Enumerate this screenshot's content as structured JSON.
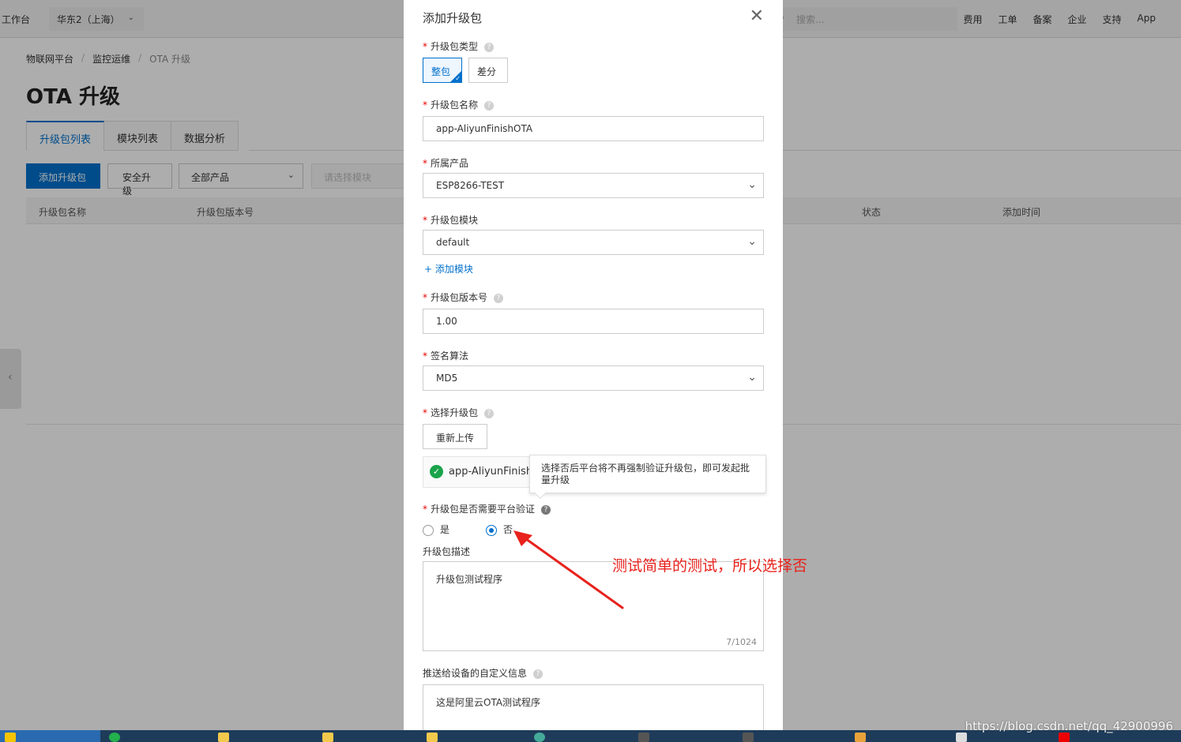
{
  "topbar": {
    "workbench": "工作台",
    "region": "华东2（上海）",
    "search_placeholder": "搜索...",
    "nav": [
      "费用",
      "工单",
      "备案",
      "企业",
      "支持",
      "App"
    ]
  },
  "breadcrumb": [
    "物联网平台",
    "监控运维",
    "OTA 升级"
  ],
  "page_title": "OTA 升级",
  "tabs": [
    "升级包列表",
    "模块列表",
    "数据分析"
  ],
  "toolbar": {
    "add_label": "添加升级包",
    "secure_label": "安全升级",
    "product_select": "全部产品",
    "module_select_placeholder": "请选择模块"
  },
  "table": {
    "headers": [
      "升级包名称",
      "升级包版本号",
      "状态",
      "添加时间"
    ]
  },
  "dialog": {
    "title": "添加升级包",
    "type_label": "升级包类型",
    "type_options": [
      "整包",
      "差分"
    ],
    "name_label": "升级包名称",
    "name_value": "app-AliyunFinishOTA",
    "product_label": "所属产品",
    "product_value": "ESP8266-TEST",
    "module_label": "升级包模块",
    "module_value": "default",
    "add_module_link": "+ 添加模块",
    "version_label": "升级包版本号",
    "version_value": "1.00",
    "sign_label": "签名算法",
    "sign_value": "MD5",
    "file_label": "选择升级包",
    "reupload_label": "重新上传",
    "file_name": "app-AliyunFinishOTA",
    "tooltip": "选择否后平台将不再强制验证升级包，即可发起批量升级",
    "verify_label": "升级包是否需要平台验证",
    "verify_options": [
      "是",
      "否"
    ],
    "verify_selected": "否",
    "desc_label": "升级包描述",
    "desc_value": "升级包测试程序",
    "desc_counter": "7/1024",
    "push_label": "推送给设备的自定义信息",
    "push_value": "这是阿里云OTA测试程序"
  },
  "annotation": "测试简单的测试，所以选择否",
  "watermark": "https://blog.csdn.net/qq_42900996",
  "colors": {
    "primary": "#0070cc",
    "required": "#e00000",
    "annotation": "#e8221c",
    "success": "#1aa34a"
  }
}
